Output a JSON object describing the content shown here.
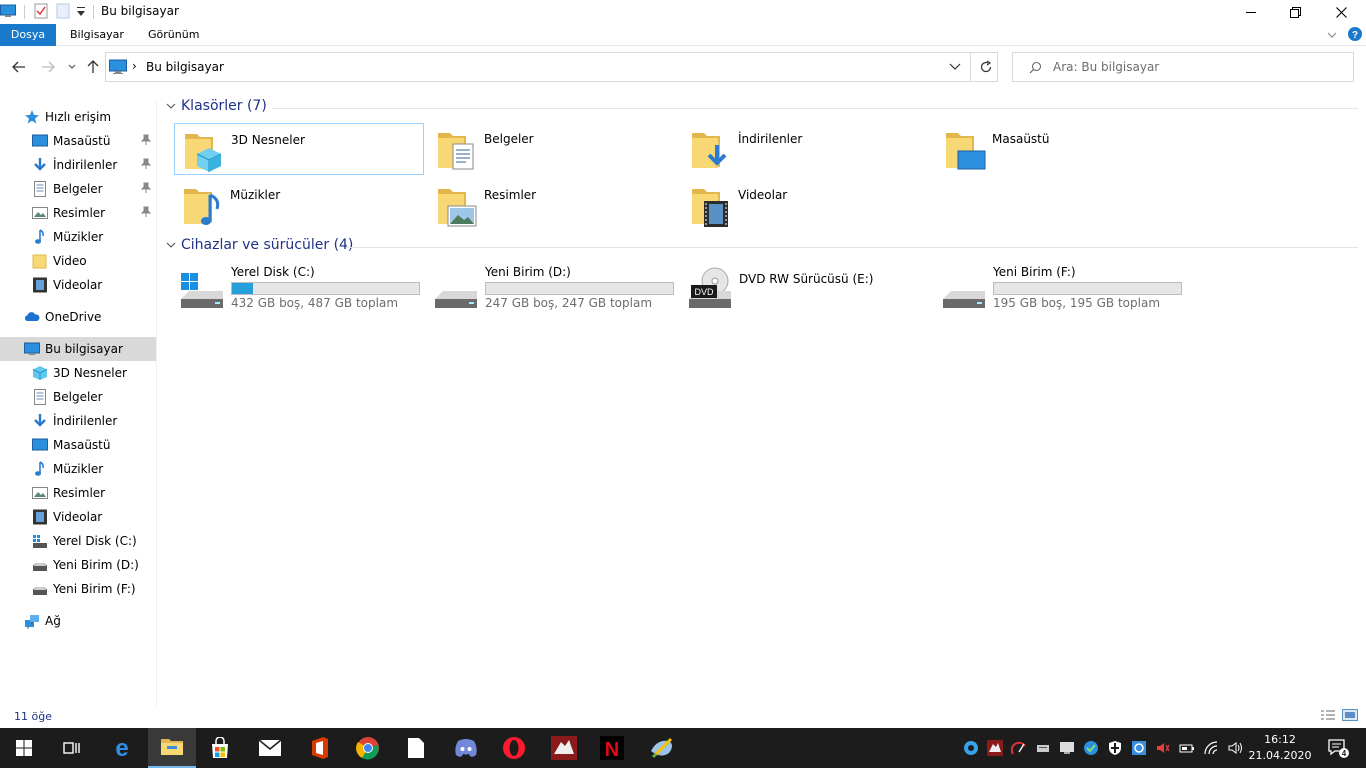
{
  "window": {
    "title": "Bu bilgisayar",
    "minimize_glyph": "—",
    "maximize_glyph": "❐",
    "close_glyph": "✕"
  },
  "ribbon": {
    "tabs": [
      "Dosya",
      "Bilgisayar",
      "Görünüm"
    ]
  },
  "address": {
    "path": "Bu bilgisayar",
    "separator": "›"
  },
  "search": {
    "placeholder": "Ara: Bu bilgisayar"
  },
  "nav": {
    "quick_access": "Hızlı erişim",
    "quick_items": [
      "Masaüstü",
      "İndirilenler",
      "Belgeler",
      "Resimler",
      "Müzikler",
      "Video",
      "Videolar"
    ],
    "onedrive": "OneDrive",
    "this_pc": "Bu bilgisayar",
    "pc_items": [
      "3D Nesneler",
      "Belgeler",
      "İndirilenler",
      "Masaüstü",
      "Müzikler",
      "Resimler",
      "Videolar",
      "Yerel Disk (C:)",
      "Yeni Birim (D:)",
      "Yeni Birim (F:)"
    ],
    "network": "Ağ"
  },
  "folders_group": {
    "label": "Klasörler (7)",
    "items": [
      "3D Nesneler",
      "Belgeler",
      "İndirilenler",
      "Masaüstü",
      "Müzikler",
      "Resimler",
      "Videolar"
    ]
  },
  "drives_group": {
    "label": "Cihazlar ve sürücüler (4)",
    "items": [
      {
        "name": "Yerel Disk (C:)",
        "usage": "432 GB boş, 487 GB toplam",
        "used_fraction": 0.113
      },
      {
        "name": "Yeni Birim (D:)",
        "usage": "247 GB boş, 247 GB toplam",
        "used_fraction": 0.0
      },
      {
        "name": "DVD RW Sürücüsü (E:)",
        "usage": "",
        "badge": "DVD"
      },
      {
        "name": "Yeni Birim (F:)",
        "usage": "195 GB boş, 195 GB toplam",
        "used_fraction": 0.0
      }
    ]
  },
  "status": {
    "count": "11 öğe"
  },
  "taskbar": {
    "time": "16:12",
    "date": "21.04.2020",
    "notifications": "4",
    "netflix_letter": "N",
    "edge_letter": "e"
  },
  "colors": {
    "accent": "#1979ca",
    "header_text": "#1e3287",
    "folder": "#f8d775",
    "drive_bar_fill": "#26a0da",
    "taskbar": "#1c1c1c"
  }
}
